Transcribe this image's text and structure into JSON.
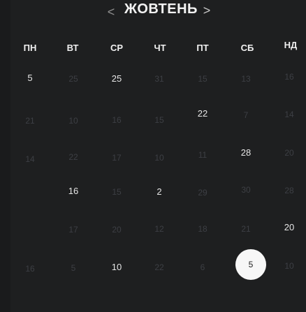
{
  "header": {
    "prev_label": "<",
    "month": "ЖОВТЕНЬ",
    "next_label": ">"
  },
  "weekdays": [
    "ПН",
    "ВТ",
    "СР",
    "ЧТ",
    "ПТ",
    "СБ",
    "НД"
  ],
  "days": {
    "r1": [
      "5",
      "25",
      "25",
      "31",
      "15",
      "13",
      "16"
    ],
    "r2": [
      "21",
      "10",
      "16",
      "15",
      "22",
      "7",
      "14"
    ],
    "r3": [
      "14",
      "22",
      "17",
      "10",
      "11",
      "28",
      "20"
    ],
    "r4": [
      "16",
      "15",
      "2",
      "29",
      "30",
      "28"
    ],
    "r5": [
      "17",
      "20",
      "12",
      "18",
      "21",
      "20"
    ],
    "r6": [
      "16",
      "5",
      "10",
      "22",
      "6",
      "5",
      "10"
    ]
  },
  "selected_day": "5"
}
